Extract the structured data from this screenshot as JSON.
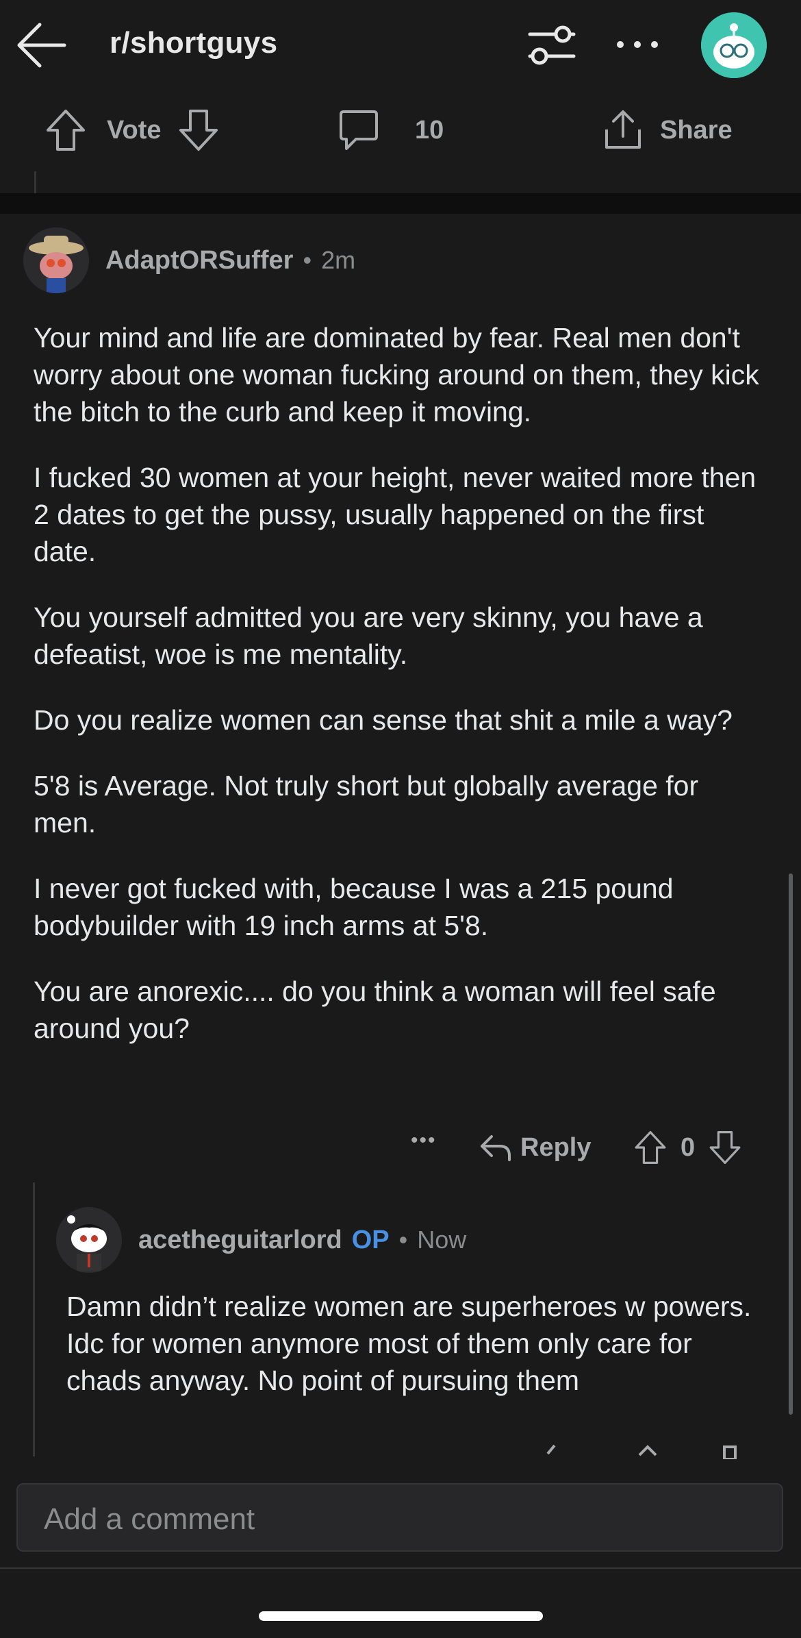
{
  "header": {
    "subreddit": "r/shortguys"
  },
  "action_bar": {
    "vote_label": "Vote",
    "comment_count": "10",
    "share_label": "Share"
  },
  "comment": {
    "author": "AdaptORSuffer",
    "separator": "•",
    "time": "2m",
    "paragraphs": [
      "Your mind and life are dominated by fear. Real men don't worry about one woman fucking around on them, they kick the bitch to the curb and keep it moving.",
      "I fucked 30 women at your height, never waited more then 2 dates to get the pussy, usually happened on the first date.",
      "You yourself admitted you are very skinny, you have a defeatist, woe is me mentality.",
      "Do you realize women can sense that shit a mile a way?",
      "5'8 is Average. Not truly short but globally average for men.",
      "I never got fucked with, because I was a 215 pound bodybuilder with 19 inch arms at 5'8.",
      "You are anorexic.... do you think a woman will feel safe around you?"
    ],
    "more_label": "•••",
    "reply_label": "Reply",
    "score": "0"
  },
  "reply": {
    "author": "acetheguitarlord",
    "op_badge": "OP",
    "separator": "•",
    "time": "Now",
    "body": "Damn didn’t realize women are superheroes w powers. Idc for women anymore most of them only care for chads anyway. No point of pursuing them"
  },
  "composer": {
    "placeholder": "Add a comment"
  },
  "colors": {
    "background": "#1a1a1b",
    "op_blue": "#4a90e2",
    "avatar_teal": "#3fc4b0"
  },
  "icons": [
    "back-arrow-icon",
    "filter-icon",
    "more-icon",
    "upvote-icon",
    "downvote-icon",
    "comment-icon",
    "share-icon",
    "reply-icon"
  ]
}
